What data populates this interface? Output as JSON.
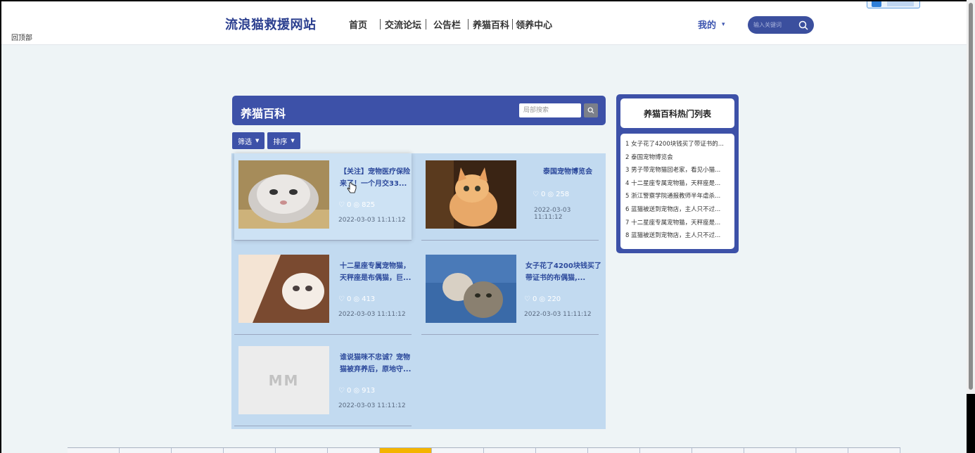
{
  "nav": {
    "corner_label": "回顶部",
    "logo": "流浪猫救援网站",
    "menu": [
      "首页",
      "交流论坛",
      "公告栏",
      "养猫百科",
      "领养中心"
    ],
    "user_menu": "我的",
    "search_placeholder": "输入关键词"
  },
  "main": {
    "title": "养猫百科",
    "local_search_placeholder": "局部搜索",
    "filter_label": "筛选",
    "sort_label": "排序",
    "cards": [
      {
        "title": "【关注】宠物医疗保险来了！一个月交33...",
        "likes": "0",
        "views": "825",
        "date": "2022-03-03 11:11:12",
        "image": "grey-kitten-photo"
      },
      {
        "title": "泰国宠物博览会",
        "likes": "0",
        "views": "258",
        "date": "2022-03-03 11:11:12",
        "image": "orange-kitten-photo"
      },
      {
        "title": "十二星座专属宠物猫，天秤座是布偶猫，巨...",
        "likes": "0",
        "views": "413",
        "date": "2022-03-03 11:11:12",
        "image": "white-kitten-photo"
      },
      {
        "title": "女子花了4200块钱买了带证书的布偶猫,...",
        "likes": "0",
        "views": "220",
        "date": "2022-03-03 11:11:12",
        "image": "tabby-kittens-photo"
      },
      {
        "title": "谁说猫咪不忠诚？宠物猫被弃养后，原地守...",
        "likes": "0",
        "views": "913",
        "date": "2022-03-03 11:11:12",
        "image": "MM"
      }
    ]
  },
  "sidebar": {
    "title": "养猫百科热门列表",
    "items": [
      "1 女子花了4200块钱买了带证书的...",
      "2 泰国宠物博览会",
      "3 男子带宠物猫回老家，看见小猫...",
      "4 十二星座专属宠物猫，天秤座是...",
      "5 浙江警察学院通报教师半年虐杀...",
      "6 蓝猫被送到宠物店，主人只不过...",
      "7 十二星座专属宠物猫，天秤座是...",
      "8 蓝猫被送到宠物店，主人只不过..."
    ]
  },
  "colors": {
    "primary": "#3d51a8",
    "page_bg": "#eef4f6",
    "grid_bg": "#c2daf0",
    "title_blue": "#2d4a9c"
  }
}
